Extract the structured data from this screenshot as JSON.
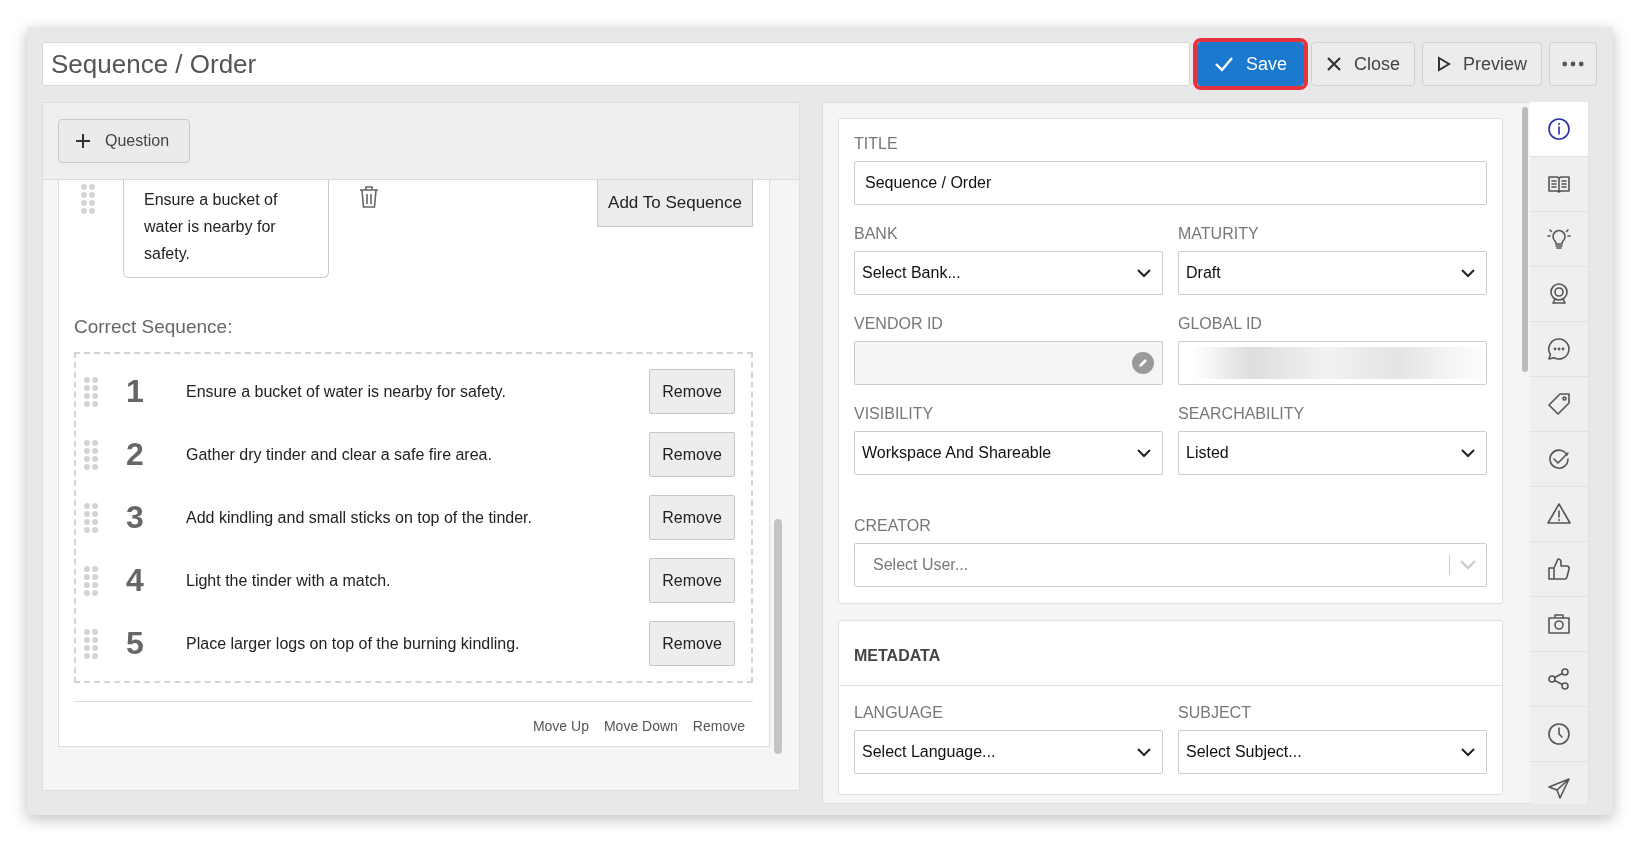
{
  "title_field": {
    "value": "Sequence / Order"
  },
  "toolbar": [
    {
      "kind": "save",
      "label": "Save",
      "highlighted": true
    },
    {
      "kind": "close",
      "label": "Close",
      "highlighted": false
    },
    {
      "kind": "preview",
      "label": "Preview",
      "highlighted": false
    },
    {
      "kind": "more",
      "highlighted": false
    }
  ],
  "editor": {
    "add_button": "Question",
    "pool_item": {
      "text": "Ensure a bucket of water is nearby for safety.",
      "button": "Add To Sequence"
    },
    "sequence_label": "Correct Sequence:",
    "sequence": [
      {
        "number": "1",
        "text": "Ensure a bucket of water is nearby for safety.",
        "button": "Remove"
      },
      {
        "number": "2",
        "text": "Gather dry tinder and clear a safe fire area.",
        "button": "Remove"
      },
      {
        "number": "3",
        "text": "Add kindling and small sticks on top of the tinder.",
        "button": "Remove"
      },
      {
        "number": "4",
        "text": "Light the tinder with a match.",
        "button": "Remove"
      },
      {
        "number": "5",
        "text": "Place larger logs on top of the burning kindling.",
        "button": "Remove"
      }
    ],
    "actions": [
      "Move Up",
      "Move Down",
      "Remove"
    ]
  },
  "properties": {
    "fields": [
      {
        "kind": "text",
        "label": "TITLE",
        "value": "Sequence / Order"
      },
      {
        "kind": "select",
        "label": "BANK",
        "value": "Select Bank..."
      },
      {
        "kind": "select",
        "label": "MATURITY",
        "value": "Draft"
      },
      {
        "kind": "readonly",
        "label": "VENDOR ID"
      },
      {
        "kind": "redacted",
        "label": "GLOBAL ID"
      },
      {
        "kind": "select",
        "label": "VISIBILITY",
        "value": "Workspace And Shareable"
      },
      {
        "kind": "select",
        "label": "SEARCHABILITY",
        "value": "Listed"
      },
      {
        "kind": "user",
        "label": "CREATOR",
        "placeholder": "Select User..."
      }
    ],
    "metadata": {
      "heading": "METADATA",
      "fields": [
        {
          "kind": "select",
          "label": "LANGUAGE",
          "value": "Select Language..."
        },
        {
          "kind": "select",
          "label": "SUBJECT",
          "value": "Select Subject..."
        }
      ]
    }
  },
  "rail": [
    {
      "kind": "info",
      "selected": true
    },
    {
      "kind": "book",
      "selected": false
    },
    {
      "kind": "bulb",
      "selected": false
    },
    {
      "kind": "webcam",
      "selected": false
    },
    {
      "kind": "chat",
      "selected": false
    },
    {
      "kind": "tag",
      "selected": false
    },
    {
      "kind": "check",
      "selected": false
    },
    {
      "kind": "warning",
      "selected": false
    },
    {
      "kind": "thumb",
      "selected": false
    },
    {
      "kind": "camera",
      "selected": false
    },
    {
      "kind": "share",
      "selected": false
    },
    {
      "kind": "clock",
      "selected": false
    },
    {
      "kind": "send",
      "selected": false
    }
  ]
}
